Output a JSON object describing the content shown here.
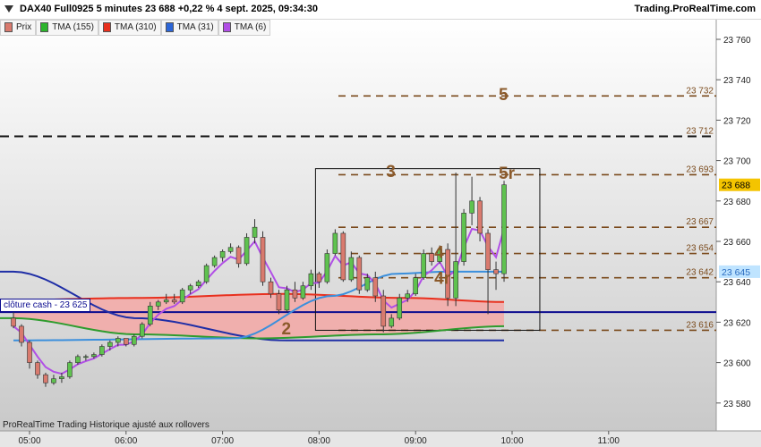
{
  "header": {
    "title": "DAX40 Full0925 5 minutes 23 688 +0,22 % 4 sept. 2025, 09:34:30",
    "brand": "Trading.ProRealTime.com"
  },
  "legend": [
    {
      "label": "Prix",
      "color": "#d97a6e"
    },
    {
      "label": "TMA (155)",
      "color": "#2db52d"
    },
    {
      "label": "TMA (310)",
      "color": "#e8301e"
    },
    {
      "label": "TMA (31)",
      "color": "#2c66d8"
    },
    {
      "label": "TMA (6)",
      "color": "#b14fe6"
    }
  ],
  "footer": "ProRealTime Trading  Historique ajusté aux rollovers",
  "cash_label": "clôture cash -  23 625",
  "colors": {
    "bull": "#5fc24f",
    "bear": "#d97a6e",
    "tma155": "#2e9c2e",
    "tma310": "#e8301e",
    "tma31": "#3b8fdc",
    "tma6": "#b14fe6",
    "tma_long": "#1f2ea6",
    "cash_line": "#0b0b8f",
    "levels": "#7a4a1c",
    "band_fill": "#f4a8a6"
  },
  "chart_data": {
    "type": "candlestick",
    "y_ticks": [
      "23 760",
      "23 740",
      "23 720",
      "23 700",
      "23 680",
      "23 660",
      "23 640",
      "23 620",
      "23 600",
      "23 580"
    ],
    "ylim": [
      23570,
      23770
    ],
    "x_ticks": [
      "05:00",
      "06:00",
      "07:00",
      "08:00",
      "09:00",
      "10:00",
      "11:00"
    ],
    "last_price": "23 688",
    "tma31_value": "23 645",
    "levels": [
      {
        "value": 23732,
        "label": "23 732",
        "style": "dashed"
      },
      {
        "value": 23712,
        "label": "23 712",
        "style": "dashed-black"
      },
      {
        "value": 23693,
        "label": "23 693",
        "style": "dashed"
      },
      {
        "value": 23667,
        "label": "23 667",
        "style": "dashed"
      },
      {
        "value": 23654,
        "label": "23 654",
        "style": "dashed"
      },
      {
        "value": 23642,
        "label": "23 642",
        "style": "dashed"
      },
      {
        "value": 23616,
        "label": "23 616",
        "style": "dashed"
      }
    ],
    "cash_close": 23625,
    "annotations": [
      {
        "text": "5",
        "time": "09:55",
        "value": 23733
      },
      {
        "text": "3",
        "time": "08:45",
        "value": 23695
      },
      {
        "text": "5r",
        "time": "09:55",
        "value": 23694
      },
      {
        "text": "4",
        "time": "09:15",
        "value": 23655
      },
      {
        "text": "4r",
        "time": "09:15",
        "value": 23642
      },
      {
        "text": "2",
        "time": "07:40",
        "value": 23617
      }
    ],
    "box": {
      "from": "08:00",
      "to": "10:15",
      "low": 23616,
      "high": 23696
    },
    "candles_start": "04:50",
    "interval_min": 5,
    "candles": [
      {
        "o": 23622,
        "h": 23626,
        "l": 23617,
        "c": 23618
      },
      {
        "o": 23618,
        "h": 23619,
        "l": 23608,
        "c": 23610
      },
      {
        "o": 23610,
        "h": 23611,
        "l": 23597,
        "c": 23600
      },
      {
        "o": 23600,
        "h": 23601,
        "l": 23592,
        "c": 23594
      },
      {
        "o": 23594,
        "h": 23595,
        "l": 23588,
        "c": 23590
      },
      {
        "o": 23590,
        "h": 23594,
        "l": 23589,
        "c": 23592
      },
      {
        "o": 23592,
        "h": 23595,
        "l": 23590,
        "c": 23593
      },
      {
        "o": 23593,
        "h": 23601,
        "l": 23592,
        "c": 23600
      },
      {
        "o": 23600,
        "h": 23604,
        "l": 23599,
        "c": 23603
      },
      {
        "o": 23603,
        "h": 23604,
        "l": 23601,
        "c": 23603
      },
      {
        "o": 23603,
        "h": 23605,
        "l": 23602,
        "c": 23604
      },
      {
        "o": 23604,
        "h": 23609,
        "l": 23603,
        "c": 23608
      },
      {
        "o": 23608,
        "h": 23611,
        "l": 23606,
        "c": 23610
      },
      {
        "o": 23610,
        "h": 23613,
        "l": 23608,
        "c": 23612
      },
      {
        "o": 23612,
        "h": 23612,
        "l": 23608,
        "c": 23609
      },
      {
        "o": 23609,
        "h": 23614,
        "l": 23608,
        "c": 23613
      },
      {
        "o": 23613,
        "h": 23620,
        "l": 23612,
        "c": 23619
      },
      {
        "o": 23619,
        "h": 23630,
        "l": 23618,
        "c": 23628
      },
      {
        "o": 23628,
        "h": 23631,
        "l": 23626,
        "c": 23630
      },
      {
        "o": 23630,
        "h": 23634,
        "l": 23629,
        "c": 23631
      },
      {
        "o": 23631,
        "h": 23634,
        "l": 23629,
        "c": 23630
      },
      {
        "o": 23630,
        "h": 23637,
        "l": 23629,
        "c": 23636
      },
      {
        "o": 23636,
        "h": 23639,
        "l": 23634,
        "c": 23638
      },
      {
        "o": 23638,
        "h": 23641,
        "l": 23637,
        "c": 23640
      },
      {
        "o": 23640,
        "h": 23649,
        "l": 23639,
        "c": 23648
      },
      {
        "o": 23648,
        "h": 23653,
        "l": 23647,
        "c": 23652
      },
      {
        "o": 23652,
        "h": 23656,
        "l": 23650,
        "c": 23655
      },
      {
        "o": 23655,
        "h": 23659,
        "l": 23654,
        "c": 23657
      },
      {
        "o": 23657,
        "h": 23658,
        "l": 23647,
        "c": 23649
      },
      {
        "o": 23649,
        "h": 23664,
        "l": 23648,
        "c": 23662
      },
      {
        "o": 23662,
        "h": 23671,
        "l": 23659,
        "c": 23667
      },
      {
        "o": 23662,
        "h": 23665,
        "l": 23638,
        "c": 23640
      },
      {
        "o": 23640,
        "h": 23642,
        "l": 23632,
        "c": 23634
      },
      {
        "o": 23634,
        "h": 23636,
        "l": 23624,
        "c": 23626
      },
      {
        "o": 23626,
        "h": 23638,
        "l": 23625,
        "c": 23636
      },
      {
        "o": 23636,
        "h": 23640,
        "l": 23630,
        "c": 23632
      },
      {
        "o": 23632,
        "h": 23640,
        "l": 23631,
        "c": 23638
      },
      {
        "o": 23638,
        "h": 23646,
        "l": 23636,
        "c": 23644
      },
      {
        "o": 23644,
        "h": 23645,
        "l": 23637,
        "c": 23640
      },
      {
        "o": 23640,
        "h": 23656,
        "l": 23639,
        "c": 23654
      },
      {
        "o": 23654,
        "h": 23666,
        "l": 23653,
        "c": 23664
      },
      {
        "o": 23664,
        "h": 23665,
        "l": 23640,
        "c": 23641
      },
      {
        "o": 23641,
        "h": 23655,
        "l": 23640,
        "c": 23652
      },
      {
        "o": 23652,
        "h": 23653,
        "l": 23634,
        "c": 23636
      },
      {
        "o": 23636,
        "h": 23644,
        "l": 23635,
        "c": 23642
      },
      {
        "o": 23642,
        "h": 23645,
        "l": 23630,
        "c": 23633
      },
      {
        "o": 23633,
        "h": 23636,
        "l": 23615,
        "c": 23618
      },
      {
        "o": 23618,
        "h": 23624,
        "l": 23617,
        "c": 23622
      },
      {
        "o": 23622,
        "h": 23634,
        "l": 23621,
        "c": 23632
      },
      {
        "o": 23632,
        "h": 23636,
        "l": 23630,
        "c": 23634
      },
      {
        "o": 23634,
        "h": 23644,
        "l": 23633,
        "c": 23642
      },
      {
        "o": 23642,
        "h": 23656,
        "l": 23641,
        "c": 23654
      },
      {
        "o": 23654,
        "h": 23657,
        "l": 23648,
        "c": 23650
      },
      {
        "o": 23650,
        "h": 23658,
        "l": 23649,
        "c": 23656
      },
      {
        "o": 23656,
        "h": 23659,
        "l": 23628,
        "c": 23632
      },
      {
        "o": 23632,
        "h": 23694,
        "l": 23628,
        "c": 23650
      },
      {
        "o": 23650,
        "h": 23676,
        "l": 23648,
        "c": 23674
      },
      {
        "o": 23674,
        "h": 23692,
        "l": 23668,
        "c": 23680
      },
      {
        "o": 23680,
        "h": 23682,
        "l": 23660,
        "c": 23664
      },
      {
        "o": 23664,
        "h": 23666,
        "l": 23624,
        "c": 23646
      },
      {
        "o": 23646,
        "h": 23650,
        "l": 23636,
        "c": 23644
      },
      {
        "o": 23644,
        "h": 23690,
        "l": 23640,
        "c": 23688
      }
    ]
  }
}
